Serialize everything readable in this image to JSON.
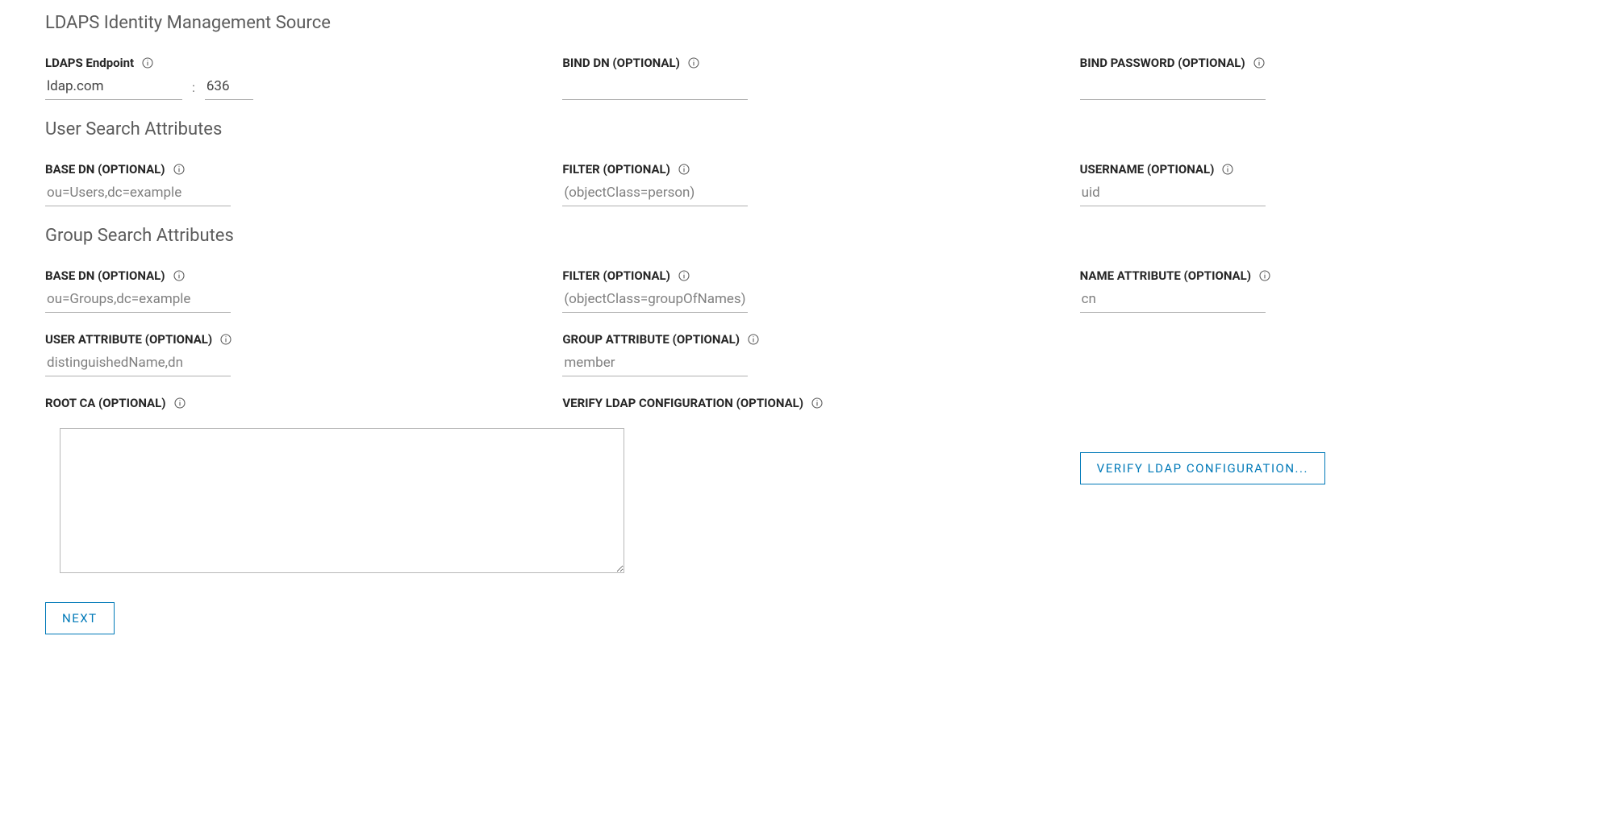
{
  "sections": {
    "identity": {
      "title": "LDAPS Identity Management Source",
      "endpoint": {
        "label": "LDAPS Endpoint",
        "host_value": "ldap.com",
        "port_value": "636",
        "separator": ":"
      },
      "bind_dn": {
        "label": "BIND DN (OPTIONAL)",
        "value": ""
      },
      "bind_password": {
        "label": "BIND PASSWORD (OPTIONAL)",
        "value": ""
      }
    },
    "user_search": {
      "title": "User Search Attributes",
      "base_dn": {
        "label": "BASE DN (OPTIONAL)",
        "placeholder": "ou=Users,dc=example",
        "value": ""
      },
      "filter": {
        "label": "FILTER (OPTIONAL)",
        "placeholder": "(objectClass=person)",
        "value": ""
      },
      "username": {
        "label": "USERNAME (OPTIONAL)",
        "placeholder": "uid",
        "value": ""
      }
    },
    "group_search": {
      "title": "Group Search Attributes",
      "base_dn": {
        "label": "BASE DN (OPTIONAL)",
        "placeholder": "ou=Groups,dc=example",
        "value": ""
      },
      "filter": {
        "label": "FILTER (OPTIONAL)",
        "placeholder": "(objectClass=groupOfNames)",
        "value": ""
      },
      "name_attribute": {
        "label": "NAME ATTRIBUTE (OPTIONAL)",
        "placeholder": "cn",
        "value": ""
      },
      "user_attribute": {
        "label": "USER ATTRIBUTE (OPTIONAL)",
        "placeholder": "distinguishedName,dn",
        "value": ""
      },
      "group_attribute": {
        "label": "GROUP ATTRIBUTE (OPTIONAL)",
        "placeholder": "member",
        "value": ""
      }
    },
    "root_ca": {
      "label": "ROOT CA (OPTIONAL)",
      "value": ""
    },
    "verify": {
      "label": "VERIFY LDAP CONFIGURATION (OPTIONAL)",
      "button": "VERIFY LDAP CONFIGURATION..."
    }
  },
  "buttons": {
    "next": "NEXT"
  }
}
